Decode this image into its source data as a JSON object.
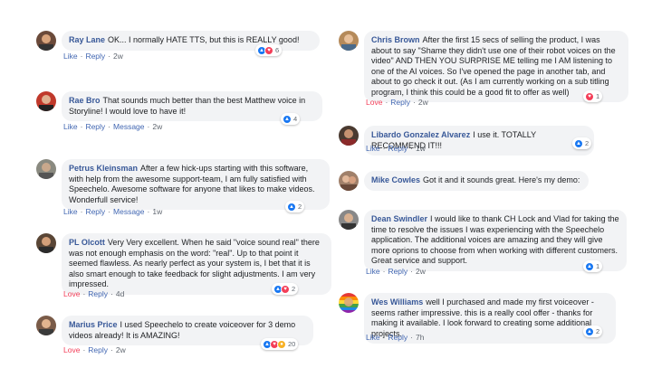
{
  "left": [
    {
      "name": "Ray Lane",
      "text": "OK... I normally HATE TTS, but this is REALLY good!",
      "actions": [
        "Like",
        "Reply"
      ],
      "time": "2w",
      "count": "6"
    },
    {
      "name": "Rae Bro",
      "text": "That sounds much better than the best Matthew voice in Storyline! I would love to have it!",
      "actions": [
        "Like",
        "Reply",
        "Message"
      ],
      "time": "2w",
      "count": "4"
    },
    {
      "name": "Petrus Kleinsman",
      "text": "After a few hick-ups starting with this software, with help from the awesome support-team, I am fully satisfied with Speechelo. Awesome software for anyone that likes to make videos. Wonderfull service!",
      "actions": [
        "Like",
        "Reply",
        "Message"
      ],
      "time": "1w",
      "count": "2"
    },
    {
      "name": "PL Olcott",
      "text": "Very Very excellent. When he said \"voice sound real\" there was not enough emphasis on the word: \"real\". Up to that point it seemed flawless. As nearly perfect as your system is, I bet that it is also smart enough to take feedback for slight adjustments. I am very impressed.",
      "actions": [
        "Love",
        "Reply"
      ],
      "time": "4d",
      "count": "2"
    },
    {
      "name": "Marius Price",
      "text": "I used Speechelo to create voiceover for 3 demo videos already! It is AMAZING!",
      "actions": [
        "Love",
        "Reply"
      ],
      "time": "2w",
      "count": "20"
    }
  ],
  "right": [
    {
      "name": "Chris Brown",
      "text": "After the first 15 secs of selling the product, I was about to say \"Shame they didn't use one of their robot voices on the video\" AND THEN YOU SURPRISE ME telling me I AM listening to one of the AI voices. So I've opened the page in another tab, and about to go check it out. (As I am currently working on a sub titling program, I think this could be a good fit to offer as well)",
      "actions": [
        "Love",
        "Reply"
      ],
      "time": "2w",
      "count": "1"
    },
    {
      "name": "Libardo Gonzalez Alvarez",
      "text": "I use it. TOTALLY RECOMMEND IT!!!",
      "actions": [
        "Like",
        "Reply"
      ],
      "time": "1w",
      "count": "2"
    },
    {
      "name": "Mike Cowles",
      "text": "Got it and it sounds great. Here's my demo:",
      "actions": [],
      "time": "",
      "count": ""
    },
    {
      "name": "Dean Swindler",
      "text": "I would like to thank CH Lock and Vlad for taking the time to resolve the issues I was experiencing with the Speechelo application. The additional voices are amazing and they will give more oprions to choose from when working with different customers. Great service and support.",
      "actions": [
        "Like",
        "Reply"
      ],
      "time": "2w",
      "count": "1"
    },
    {
      "name": "Wes Williams",
      "text": "well I purchased and made my first voiceover - seems rather impressive. this is a really cool offer - thanks for making it available. I look forward to creating some additional projects.",
      "actions": [
        "Like",
        "Reply"
      ],
      "time": "7h",
      "count": "2"
    }
  ]
}
